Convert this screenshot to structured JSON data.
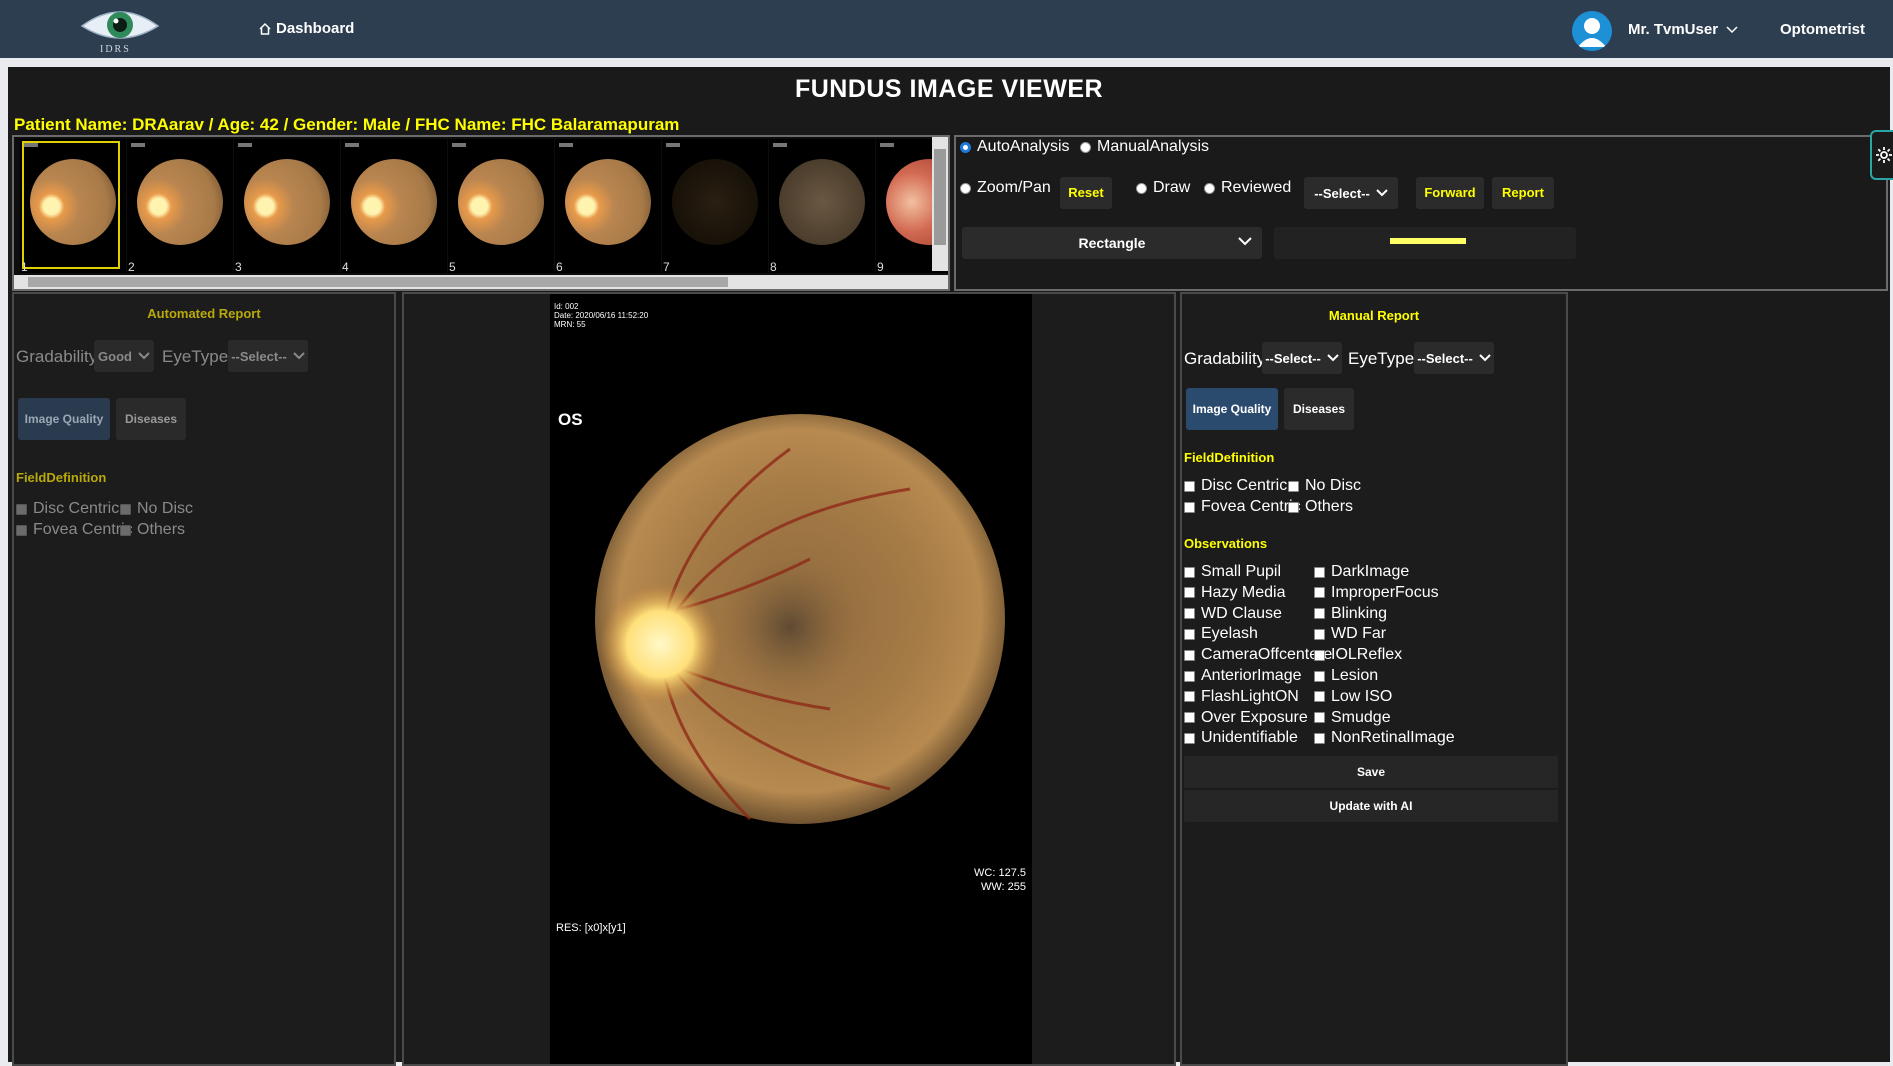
{
  "header": {
    "logo_text": "IDRS",
    "nav_dashboard": "Dashboard",
    "user_name": "Mr. TvmUser",
    "role": "Optometrist"
  },
  "viewer": {
    "title": "FUNDUS IMAGE VIEWER",
    "patient_info": "Patient Name: DRAarav /  Age: 42 /  Gender: Male /  FHC Name: FHC Balaramapuram",
    "thumbnails": [
      {
        "num": "1",
        "selected": true,
        "style": "normal"
      },
      {
        "num": "2",
        "selected": false,
        "style": "normal"
      },
      {
        "num": "3",
        "selected": false,
        "style": "normal"
      },
      {
        "num": "4",
        "selected": false,
        "style": "normal"
      },
      {
        "num": "5",
        "selected": false,
        "style": "normal"
      },
      {
        "num": "6",
        "selected": false,
        "style": "normal"
      },
      {
        "num": "7",
        "selected": false,
        "style": "dark"
      },
      {
        "num": "8",
        "selected": false,
        "style": "dim"
      },
      {
        "num": "9",
        "selected": false,
        "style": "red"
      }
    ]
  },
  "controls": {
    "auto_analysis": "AutoAnalysis",
    "manual_analysis": "ManualAnalysis",
    "zoom_pan": "Zoom/Pan",
    "reset": "Reset",
    "draw": "Draw",
    "reviewed": "Reviewed",
    "select": "--Select--",
    "forward": "Forward",
    "report": "Report",
    "shape": "Rectangle",
    "draw_color": "#ffff66"
  },
  "automated_report": {
    "title": "Automated Report",
    "gradability_label": "Gradability:",
    "gradability_value": "Good",
    "eyetype_label": "EyeType:",
    "eyetype_value": "--Select--",
    "tab_image_quality": "Image Quality",
    "tab_diseases": "Diseases",
    "field_definition": "FieldDefinition",
    "fields": [
      "Disc Centric",
      "No Disc",
      "Fovea Centric",
      "Others"
    ]
  },
  "image": {
    "meta_id": "Id: 002",
    "meta_date": "Date: 2020/06/16 11:52:20",
    "meta_mrn": "MRN: 55",
    "eye": "OS",
    "wc": "WC: 127.5",
    "ww": "WW: 255",
    "res": "RES: [x0]x[y1]"
  },
  "manual_report": {
    "title": "Manual Report",
    "gradability_label": "Gradability:",
    "gradability_value": "--Select--",
    "eyetype_label": "EyeType:",
    "eyetype_value": "--Select--",
    "tab_image_quality": "Image Quality",
    "tab_diseases": "Diseases",
    "field_definition": "FieldDefinition",
    "fields": [
      "Disc Centric",
      "No Disc",
      "Fovea Centric",
      "Others"
    ],
    "observations_title": "Observations",
    "observations_left": [
      "Small Pupil",
      "Hazy Media",
      "WD Clause",
      "Eyelash",
      "CameraOffcentere",
      "AnteriorImage",
      "FlashLightON",
      "Over Exposure",
      "Unidentifiable"
    ],
    "observations_right": [
      "DarkImage",
      "ImproperFocus",
      "Blinking",
      "WD Far",
      "IOLReflex",
      "Lesion",
      "Low ISO",
      "Smudge",
      "NonRetinalImage"
    ],
    "save": "Save",
    "update_ai": "Update with AI"
  },
  "colors": {
    "topbar": "#2d3e50",
    "accent_yellow": "#ffff00",
    "active_tab": "#2a4a6e"
  }
}
